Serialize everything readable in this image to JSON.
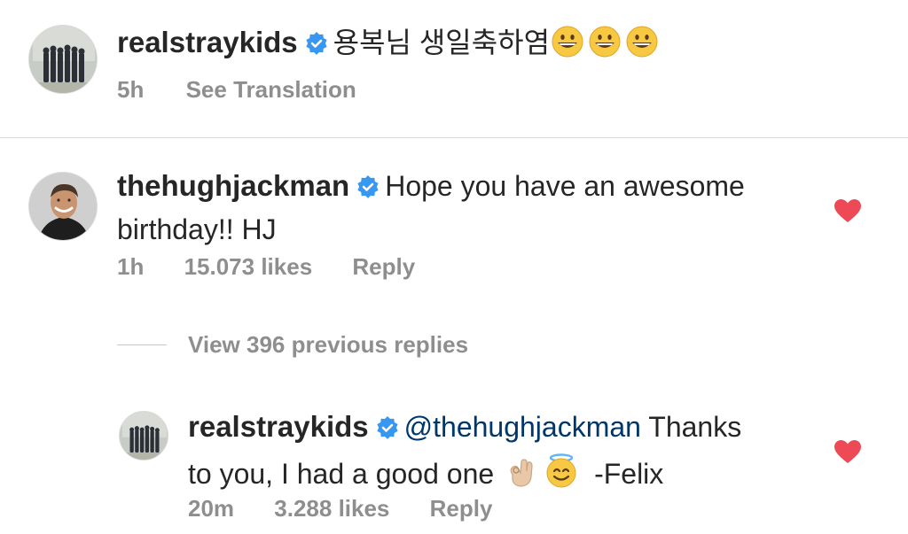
{
  "colors": {
    "verified": "#3897f0",
    "heart": "#ed4956",
    "meta": "#8e8e8e",
    "mention": "#00376b"
  },
  "comments": [
    {
      "username": "realstraykids",
      "text": "용복님 생일축하염",
      "emojis": [
        "grinning-face-icon",
        "grinning-face-icon",
        "grinning-face-icon"
      ],
      "time": "5h",
      "translate_label": "See Translation"
    },
    {
      "username": "thehughjackman",
      "text_line1": "Hope you have an awesome",
      "text_line2": "birthday!! HJ",
      "time": "1h",
      "likes": "15.073 likes",
      "reply_label": "Reply",
      "liked": true
    }
  ],
  "view_replies_label": "View 396 previous replies",
  "reply": {
    "username": "realstraykids",
    "mention": "@thehughjackman",
    "text_line1_rest": "Thanks",
    "text_line2": "to you, I had a good one",
    "emojis": [
      "ok-hand-icon",
      "smiling-face-with-halo-icon"
    ],
    "signature": "-Felix",
    "time": "20m",
    "likes": "3.288 likes",
    "reply_label": "Reply",
    "liked": true
  }
}
